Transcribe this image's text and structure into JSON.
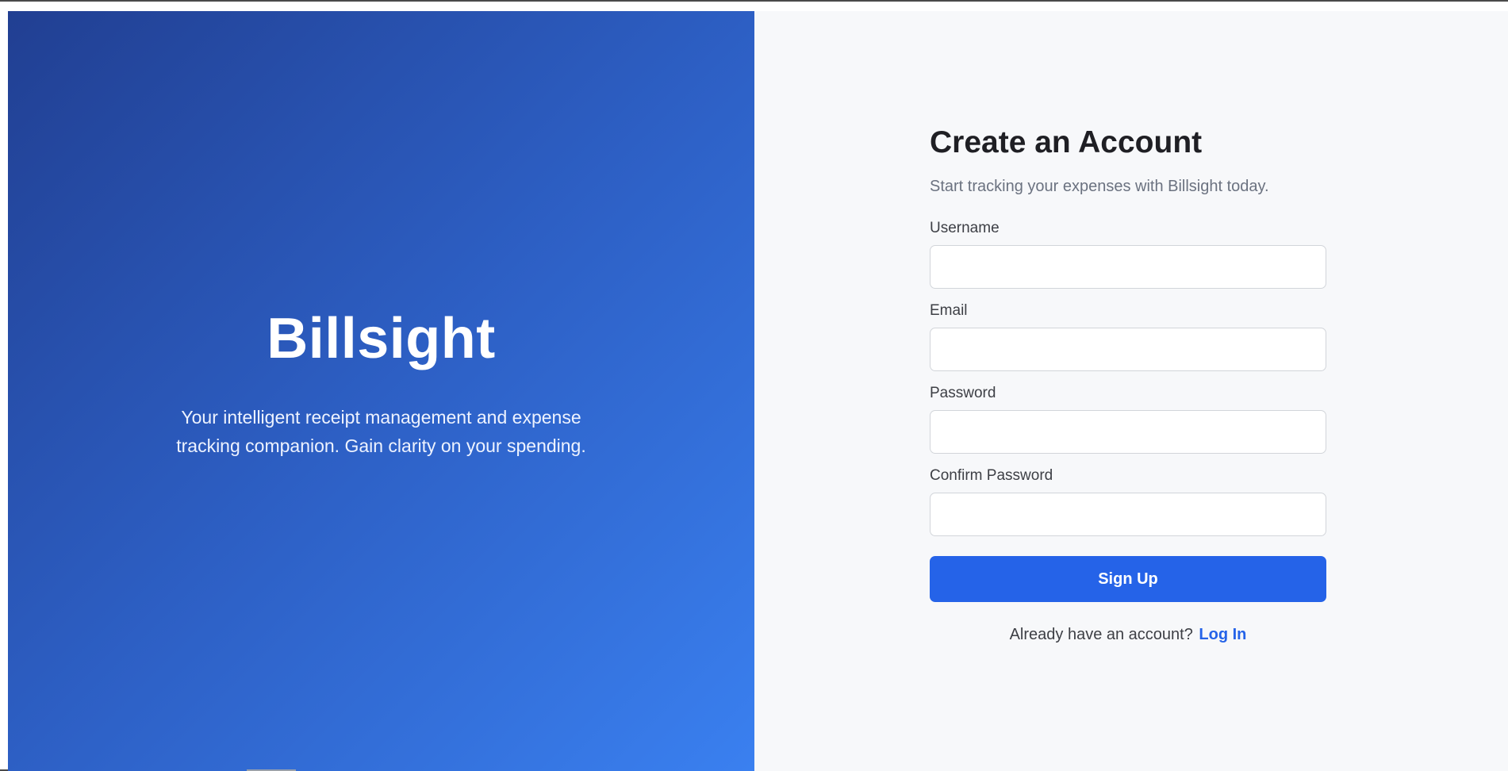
{
  "brand": {
    "title": "Billsight",
    "tagline": "Your intelligent receipt management and expense tracking companion. Gain clarity on your spending."
  },
  "form": {
    "title": "Create an Account",
    "subtitle": "Start tracking your expenses with Billsight today.",
    "fields": [
      {
        "label": "Username",
        "value": "",
        "placeholder": ""
      },
      {
        "label": "Email",
        "value": "",
        "placeholder": ""
      },
      {
        "label": "Password",
        "value": "",
        "placeholder": ""
      },
      {
        "label": "Confirm Password",
        "value": "",
        "placeholder": ""
      }
    ],
    "submit_label": "Sign Up",
    "login_prompt": "Already have an account?",
    "login_link": "Log In"
  },
  "colors": {
    "gradient_start": "#213f92",
    "gradient_end": "#3a80f0",
    "accent": "#2563e8",
    "panel_background": "#f7f8fa"
  }
}
